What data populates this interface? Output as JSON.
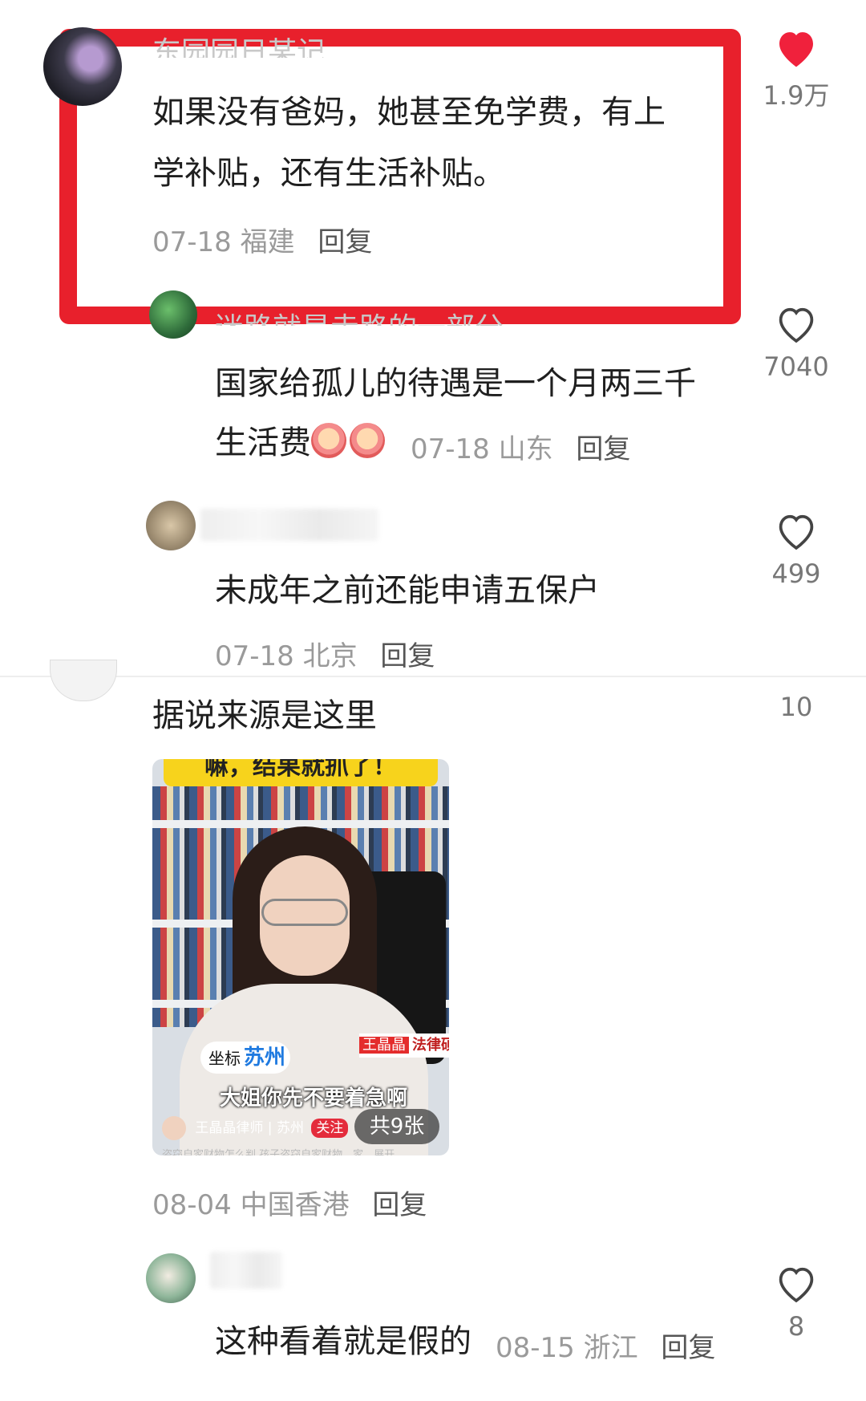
{
  "comments": [
    {
      "id": "c1",
      "name_partial": "东园园日某记",
      "text_lines": [
        "如果没有爸妈，她甚至免学费，有上",
        "学补贴，还有生活补贴。"
      ],
      "date": "07-18",
      "location": "福建",
      "reply_label": "回复",
      "likes": "1.9万",
      "liked": true
    },
    {
      "id": "c2",
      "name_partial": "迷路就是走路的一部分",
      "text_lines": [
        "国家给孤儿的待遇是一个月两三千",
        "生活费"
      ],
      "emoji": [
        "crying-face",
        "crying-face"
      ],
      "date": "07-18",
      "location": "山东",
      "reply_label": "回复",
      "likes": "7040"
    },
    {
      "id": "c3",
      "text_lines": [
        "未成年之前还能申请五保户"
      ],
      "date": "07-18",
      "location": "北京",
      "reply_label": "回复",
      "likes": "499"
    },
    {
      "id": "c4",
      "text_lines": [
        "据说来源是这里"
      ],
      "image": {
        "banner_text": "嘛，结果就抓了！",
        "location_tag": "苏州",
        "location_prefix": "坐标",
        "name_tag": "王晶晶",
        "title_tag": "法律硕士",
        "subtitle": "大姐你先不要着急啊",
        "account": "王晶晶律师 | 苏州",
        "follow": "关注",
        "count": "共9张",
        "caption": "盗窃自家财物怎么判 孩子盗窃自家财物，家…展开"
      },
      "date": "08-04",
      "location": "中国香港",
      "reply_label": "回复",
      "likes": "10"
    },
    {
      "id": "c5",
      "text_lines": [
        "这种看着就是假的"
      ],
      "date": "08-15",
      "location": "浙江",
      "reply_label": "回复",
      "likes": "8"
    }
  ],
  "colors": {
    "highlight": "#e8202c",
    "liked": "#f0213c",
    "text": "#1f1f1f",
    "meta": "#9a9a9a"
  }
}
